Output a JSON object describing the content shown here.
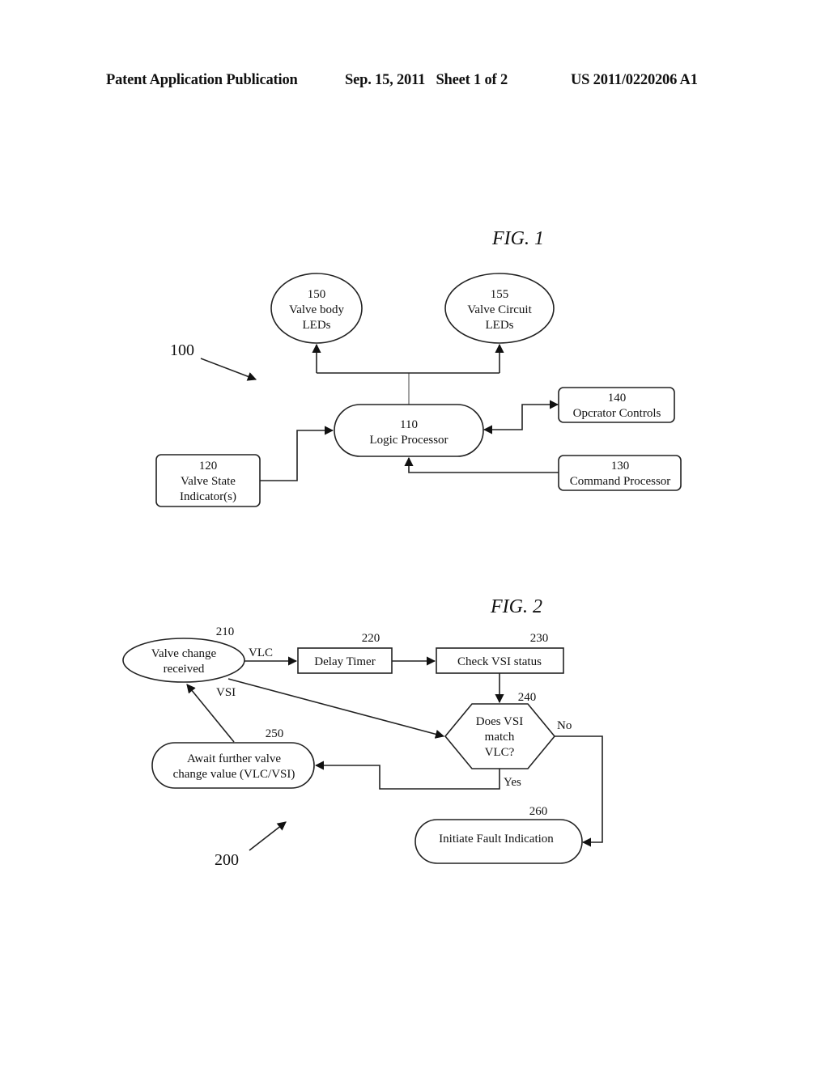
{
  "header": {
    "publication": "Patent Application Publication",
    "date_sheet": "Sep. 15, 2011   Sheet 1 of 2",
    "number": "US 2011/0220206 A1"
  },
  "fig1": {
    "title": "FIG. 1",
    "ref": "100",
    "nodes": {
      "n150": {
        "num": "150",
        "line1": "Valve body",
        "line2": "LEDs"
      },
      "n155": {
        "num": "155",
        "line1": "Valve Circuit",
        "line2": "LEDs"
      },
      "n110": {
        "num": "110",
        "line1": "Logic Processor"
      },
      "n140": {
        "num": "140",
        "line1": "Opcrator Controls"
      },
      "n130": {
        "num": "130",
        "line1": "Command Processor"
      },
      "n120": {
        "num": "120",
        "line1": "Valve State",
        "line2": "Indicator(s)"
      }
    }
  },
  "fig2": {
    "title": "FIG. 2",
    "ref": "200",
    "nodes": {
      "n210": {
        "num": "210",
        "line1": "Valve change",
        "line2": "received"
      },
      "n220": {
        "num": "220",
        "line1": "Delay Timer"
      },
      "n230": {
        "num": "230",
        "line1": "Check VSI status"
      },
      "n240": {
        "num": "240",
        "line1": "Does VSI",
        "line2": "match",
        "line3": "VLC?"
      },
      "n250": {
        "num": "250",
        "line1": "Await further valve",
        "line2": "change value (VLC/VSI)"
      },
      "n260": {
        "num": "260",
        "line1": "Initiate Fault Indication"
      }
    },
    "edge_labels": {
      "vlc": "VLC",
      "vsi": "VSI",
      "no": "No",
      "yes": "Yes"
    }
  }
}
